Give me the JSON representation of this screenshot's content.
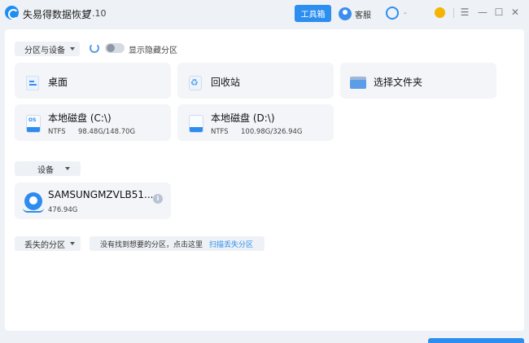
{
  "app": {
    "title": "失易得数据恢复",
    "version": "7.10",
    "toolbox_label": "工具箱",
    "service_label": "客服",
    "user_label": "-",
    "accent": "#2c8ff0"
  },
  "window_controls": [
    "menu-icon",
    "minimize-icon",
    "maximize-icon",
    "close-icon"
  ],
  "partitions": {
    "dropdown_label": "分区与设备",
    "show_hidden_label": "显示隐藏分区",
    "show_hidden_on": false
  },
  "quick_locations": [
    {
      "name": "桌面",
      "icon": "desktop-icon"
    },
    {
      "name": "回收站",
      "icon": "recycle-bin-icon"
    },
    {
      "name": "选择文件夹",
      "icon": "folder-icon"
    }
  ],
  "disks": [
    {
      "name": "本地磁盘 (C:\\)",
      "fs": "NTFS",
      "usage": "98.48G/148.70G",
      "badge": "OS"
    },
    {
      "name": "本地磁盘 (D:\\)",
      "fs": "NTFS",
      "usage": "100.98G/326.94G",
      "badge": ""
    }
  ],
  "devices_section": {
    "dropdown_label": "设备",
    "items": [
      {
        "name": "SAMSUNGMZVLB51...",
        "size": "476.94G"
      }
    ]
  },
  "lost_partitions": {
    "dropdown_label": "丢失的分区",
    "hint": "没有找到想要的分区，点击这里",
    "link": "扫描丢失分区"
  }
}
